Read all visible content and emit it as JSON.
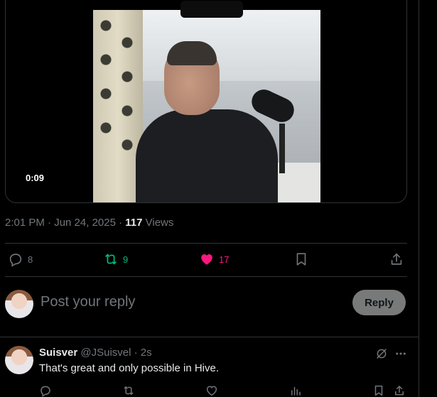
{
  "video": {
    "timestamp": "0:09"
  },
  "tweet": {
    "time": "2:01 PM · Jun 24, 2025 · ",
    "views_count": "117",
    "views_label": " Views"
  },
  "actions": {
    "replies": "8",
    "reposts": "9",
    "likes": "17"
  },
  "composer": {
    "placeholder": "Post your reply",
    "reply_label": "Reply"
  },
  "reply": {
    "name": "Suisver",
    "handle": "@JSuisvel · 2s",
    "text": "That's great and only possible in Hive."
  },
  "icons": [
    "comment-icon",
    "repost-icon",
    "heart-icon",
    "bookmark-icon",
    "share-icon",
    "grok-icon",
    "more-icon",
    "views-icon"
  ],
  "colors": {
    "background": "#000000",
    "repost_active": "#00ba7c",
    "like_active": "#f91880",
    "muted": "#71767b",
    "reply_button": "#787a7a"
  }
}
